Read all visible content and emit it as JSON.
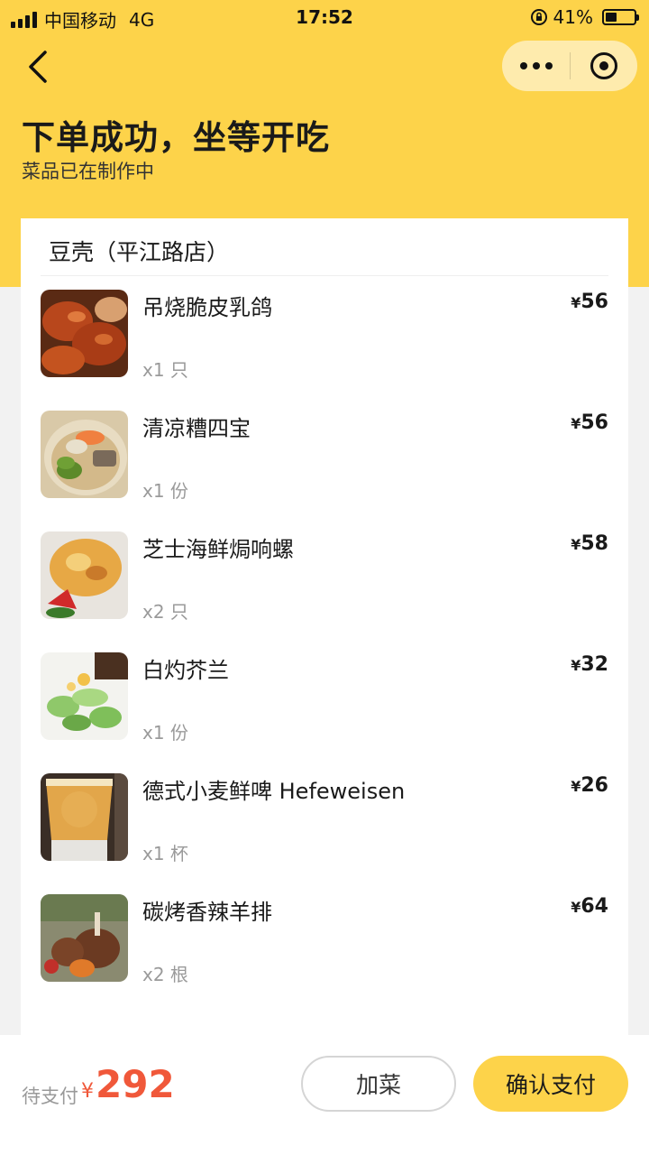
{
  "status_bar": {
    "carrier": "中国移动",
    "network": "4G",
    "time": "17:52",
    "battery": "41%"
  },
  "header": {
    "title": "下单成功，坐等开吃",
    "subtitle": "菜品已在制作中"
  },
  "order": {
    "store_name": "豆壳（平江路店）",
    "currency_symbol": "¥",
    "items": [
      {
        "name": "吊烧脆皮乳鸽",
        "qty": "x1 只",
        "price": "56",
        "thumb_icon": "roast-pigeon-photo"
      },
      {
        "name": "清凉糟四宝",
        "qty": "x1 份",
        "price": "56",
        "thumb_icon": "cold-dish-photo"
      },
      {
        "name": "芝士海鲜焗响螺",
        "qty": "x2 只",
        "price": "58",
        "thumb_icon": "baked-conch-photo"
      },
      {
        "name": "白灼芥兰",
        "qty": "x1 份",
        "price": "32",
        "thumb_icon": "kale-photo"
      },
      {
        "name": "德式小麦鲜啤 Hefeweisen",
        "qty": "x1 杯",
        "price": "26",
        "thumb_icon": "beer-photo"
      },
      {
        "name": "碳烤香辣羊排",
        "qty": "x2 根",
        "price": "64",
        "thumb_icon": "lamb-chop-photo"
      }
    ]
  },
  "footer": {
    "total_label": "待支付",
    "total_yen": "¥",
    "total_amount": "292",
    "add_button": "加菜",
    "confirm_button": "确认支付"
  },
  "colors": {
    "brand_yellow": "#fdd34a",
    "price_orange": "#f0583a"
  }
}
